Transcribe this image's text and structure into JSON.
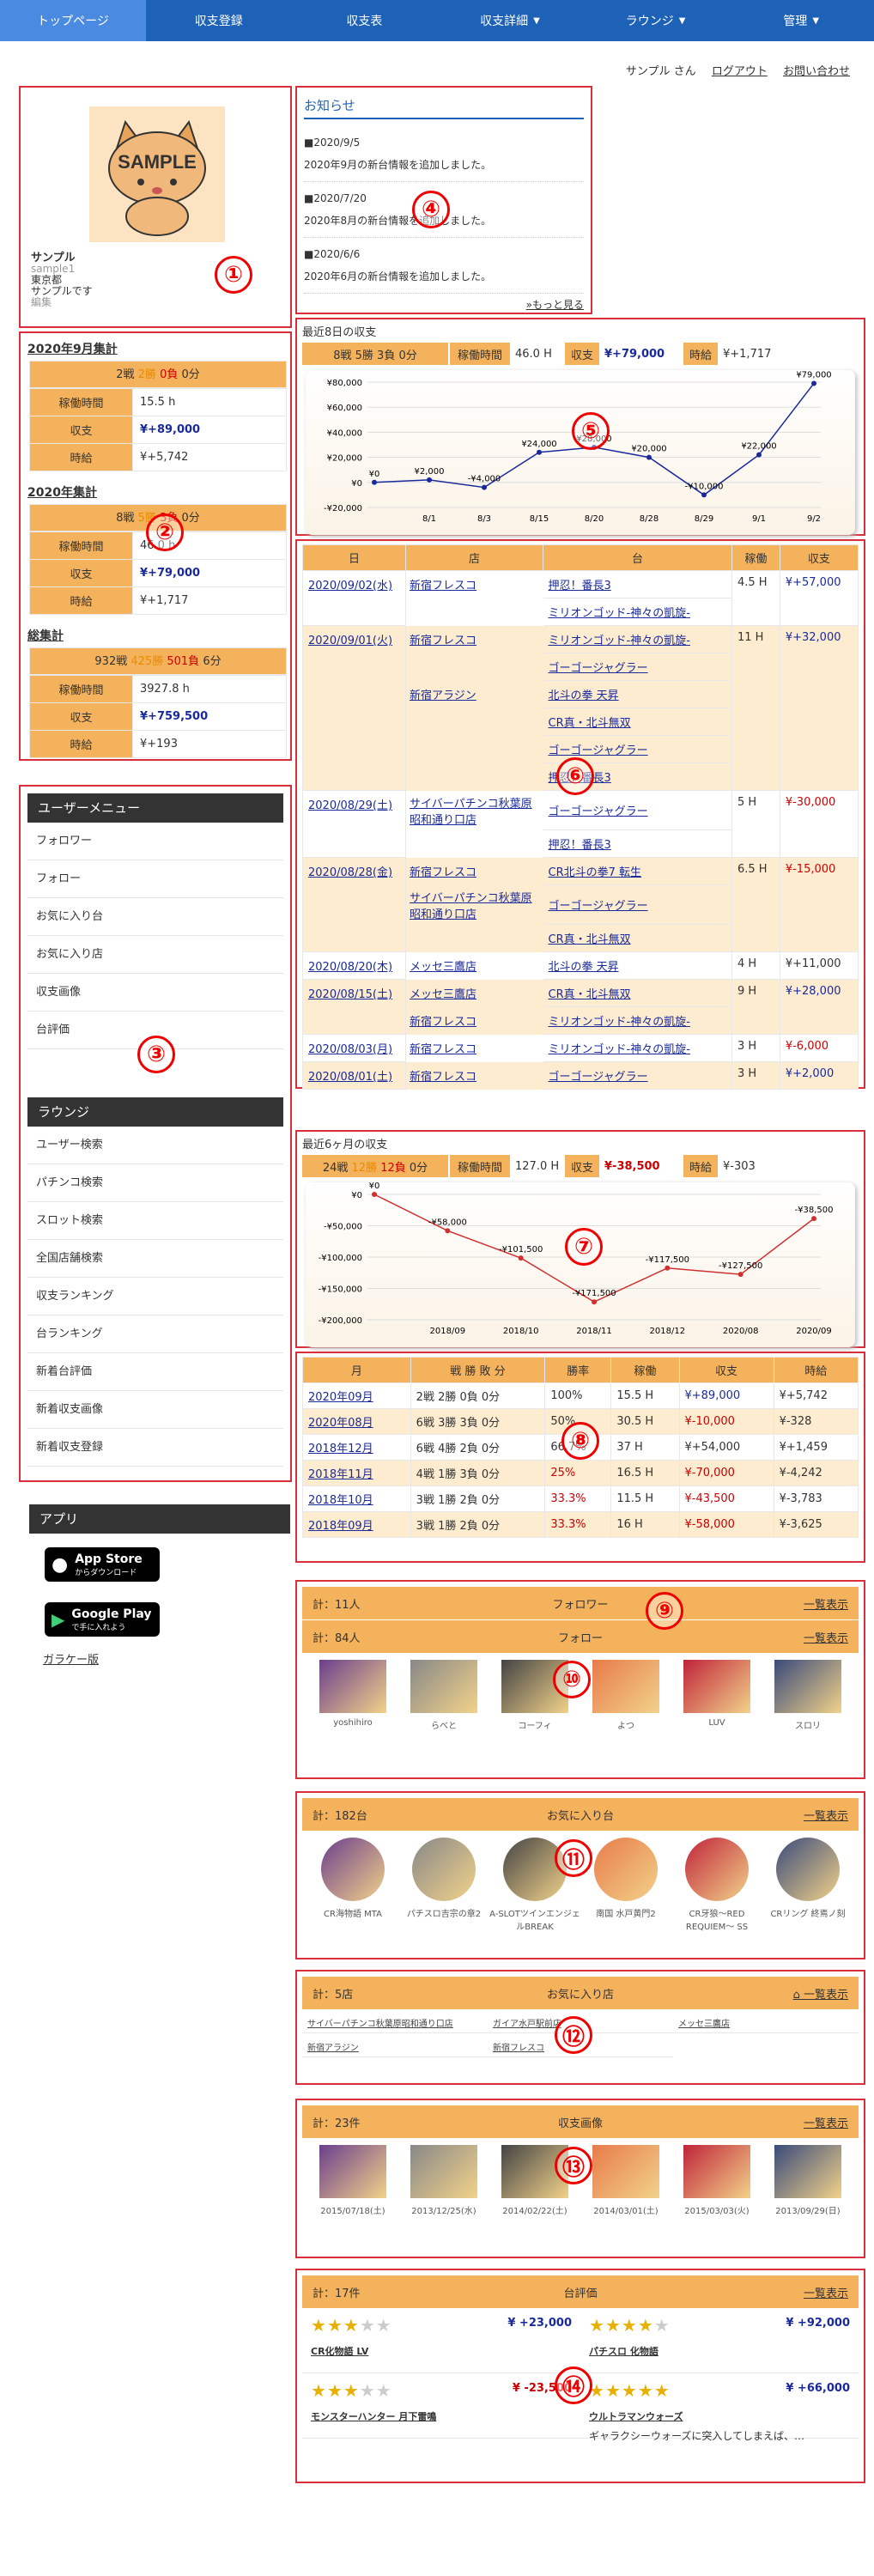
{
  "nav": {
    "items": [
      "トップページ",
      "収支登録",
      "収支表",
      "収支詳細",
      "ラウンジ",
      "管理"
    ]
  },
  "userbar": {
    "name": "サンプル",
    "suffix": "さん",
    "logout": "ログアウト",
    "contact": "お問い合わせ"
  },
  "profile": {
    "avatar_text": "SAMPLE",
    "name": "サンプル",
    "id": "sample1",
    "area": "東京都",
    "comment": "サンプルです",
    "edit": "編集"
  },
  "month_summary": {
    "title": "2020年9月集計",
    "games": "2戦",
    "wins": "2勝",
    "losses": "0負",
    "draws": "0分",
    "hours_label": "稼働時間",
    "hours": "15.5 h",
    "balance_label": "収支",
    "balance": "¥+89,000",
    "hourly_label": "時給",
    "hourly": "¥+5,742"
  },
  "year_summary": {
    "title": "2020年集計",
    "games": "8戦",
    "wins": "5勝",
    "losses": "3負",
    "draws": "0分",
    "hours_label": "稼働時間",
    "hours": "46.0 h",
    "balance_label": "収支",
    "balance": "¥+79,000",
    "hourly_label": "時給",
    "hourly": "¥+1,717"
  },
  "total_summary": {
    "title": "総集計",
    "games": "932戦",
    "wins": "425勝",
    "losses": "501負",
    "draws": "6分",
    "hours_label": "稼働時間",
    "hours": "3927.8 h",
    "balance_label": "収支",
    "balance": "¥+759,500",
    "hourly_label": "時給",
    "hourly": "¥+193"
  },
  "user_menu": {
    "title": "ユーザーメニュー",
    "items": [
      "フォロワー",
      "フォロー",
      "お気に入り台",
      "お気に入り店",
      "収支画像",
      "台評価"
    ]
  },
  "lounge_menu": {
    "title": "ラウンジ",
    "items": [
      "ユーザー検索",
      "パチンコ検索",
      "スロット検索",
      "全国店舗検索",
      "収支ランキング",
      "台ランキング",
      "新着台評価",
      "新着収支画像",
      "新着収支登録"
    ]
  },
  "apps": {
    "title": "アプリ",
    "appstore_main": "App Store",
    "appstore_sub": "からダウンロード",
    "google_main": "Google Play",
    "google_sub": "で手に入れよう",
    "feature": "ガラケー版"
  },
  "notice": {
    "title": "お知らせ",
    "items": [
      {
        "date": "■2020/9/5",
        "text": "2020年9月の新台情報を追加しました。"
      },
      {
        "date": "■2020/7/20",
        "text": "2020年8月の新台情報を追加しました。"
      },
      {
        "date": "■2020/6/6",
        "text": "2020年6月の新台情報を追加しました。"
      }
    ],
    "more": "»もっと見る"
  },
  "recent8": {
    "title": "最近8日の収支",
    "record": "8戦 5勝 3負 0分",
    "hours_label": "稼働時間",
    "hours": "46.0 H",
    "balance_label": "収支",
    "balance": "¥+79,000",
    "hourly_label": "時給",
    "hourly": "¥+1,717"
  },
  "chart_data": [
    {
      "type": "line",
      "categories": [
        "8/1",
        "8/3",
        "8/15",
        "8/20",
        "8/28",
        "8/29",
        "9/1",
        "9/2"
      ],
      "values": [
        0,
        2000,
        -4000,
        24000,
        28000,
        20000,
        -10000,
        22000,
        79000
      ],
      "labels": [
        "¥0",
        "¥2,000",
        "-¥4,000",
        "¥24,000",
        "¥28,000",
        "¥20,000",
        "-¥10,000",
        "¥22,000",
        "¥79,000"
      ],
      "ylim": [
        -20000,
        80000
      ],
      "yticks": [
        "¥80,000",
        "¥60,000",
        "¥40,000",
        "¥20,000",
        "¥0",
        "-¥20,000"
      ]
    },
    {
      "type": "line",
      "categories": [
        "2018/09",
        "2018/10",
        "2018/11",
        "2018/12",
        "2020/08",
        "2020/09"
      ],
      "values": [
        0,
        -58000,
        -101500,
        -171500,
        -117500,
        -127500,
        -38500
      ],
      "labels": [
        "¥0",
        "-¥58,000",
        "-¥101,500",
        "-¥171,500",
        "-¥117,500",
        "-¥127,500",
        "-¥38,500"
      ],
      "ylim": [
        -200000,
        0
      ],
      "yticks": [
        "¥0",
        "-¥50,000",
        "-¥100,000",
        "-¥150,000",
        "-¥200,000"
      ]
    }
  ],
  "daily_table": {
    "headers": [
      "日",
      "店",
      "台",
      "稼働",
      "収支"
    ],
    "rows": [
      {
        "date": "2020/09/02(水)",
        "entries": [
          {
            "store": "新宿フレスコ",
            "machines": [
              "押忍！番長3",
              "ミリオンゴッド-神々の凱旋-"
            ]
          }
        ],
        "hours": "4.5 H",
        "balance": "¥+57,000",
        "sign": "pos",
        "cream": false
      },
      {
        "date": "2020/09/01(火)",
        "entries": [
          {
            "store": "新宿フレスコ",
            "machines": [
              "ミリオンゴッド-神々の凱旋-",
              "ゴーゴージャグラー"
            ]
          },
          {
            "store": "新宿アラジン",
            "machines": [
              "北斗の拳 天昇",
              "CR真・北斗無双",
              "ゴーゴージャグラー",
              "押忍！番長3"
            ]
          }
        ],
        "hours": "11 H",
        "balance": "¥+32,000",
        "sign": "pos",
        "cream": true
      },
      {
        "date": "2020/08/29(土)",
        "entries": [
          {
            "store": "サイバーパチンコ秋葉原昭和通り口店",
            "machines": [
              "ゴーゴージャグラー",
              "押忍！番長3"
            ]
          }
        ],
        "hours": "5 H",
        "balance": "¥-30,000",
        "sign": "neg",
        "cream": false
      },
      {
        "date": "2020/08/28(金)",
        "entries": [
          {
            "store": "新宿フレスコ",
            "machines": [
              "CR北斗の拳7 転生"
            ]
          },
          {
            "store": "サイバーパチンコ秋葉原昭和通り口店",
            "machines": [
              "ゴーゴージャグラー",
              "CR真・北斗無双"
            ]
          }
        ],
        "hours": "6.5 H",
        "balance": "¥-15,000",
        "sign": "neg",
        "cream": true
      },
      {
        "date": "2020/08/20(木)",
        "entries": [
          {
            "store": "メッセ三鷹店",
            "machines": [
              "北斗の拳 天昇"
            ]
          }
        ],
        "hours": "4 H",
        "balance": "¥+11,000",
        "sign": "",
        "cream": false
      },
      {
        "date": "2020/08/15(土)",
        "entries": [
          {
            "store": "メッセ三鷹店",
            "machines": [
              "CR真・北斗無双"
            ]
          },
          {
            "store": "新宿フレスコ",
            "machines": [
              "ミリオンゴッド-神々の凱旋-"
            ]
          }
        ],
        "hours": "9 H",
        "balance": "¥+28,000",
        "sign": "pos",
        "cream": true
      },
      {
        "date": "2020/08/03(月)",
        "entries": [
          {
            "store": "新宿フレスコ",
            "machines": [
              "ミリオンゴッド-神々の凱旋-"
            ]
          }
        ],
        "hours": "3 H",
        "balance": "¥-6,000",
        "sign": "neg",
        "cream": false
      },
      {
        "date": "2020/08/01(土)",
        "entries": [
          {
            "store": "新宿フレスコ",
            "machines": [
              "ゴーゴージャグラー"
            ]
          }
        ],
        "hours": "3 H",
        "balance": "¥+2,000",
        "sign": "pos",
        "cream": true
      }
    ]
  },
  "recent6": {
    "title": "最近6ヶ月の収支",
    "games": "24戦",
    "wins": "12勝",
    "losses": "12負",
    "draws": "0分",
    "hours_label": "稼働時間",
    "hours": "127.0 H",
    "balance_label": "収支",
    "balance": "¥-38,500",
    "hourly_label": "時給",
    "hourly": "¥-303"
  },
  "monthly_table": {
    "headers": [
      "月",
      "戦 勝 敗 分",
      "勝率",
      "稼働",
      "収支",
      "時給"
    ],
    "rows": [
      {
        "month": "2020年09月",
        "record": "2戦 2勝 0負 0分",
        "rate": "100%",
        "hours": "15.5 H",
        "balance": "¥+89,000",
        "hourly": "¥+5,742",
        "sign": "pos",
        "rate_red": false
      },
      {
        "month": "2020年08月",
        "record": "6戦 3勝 3負 0分",
        "rate": "50%",
        "hours": "30.5 H",
        "balance": "¥-10,000",
        "hourly": "¥-328",
        "sign": "neg",
        "rate_red": false
      },
      {
        "month": "2018年12月",
        "record": "6戦 4勝 2負 0分",
        "rate": "66.7%",
        "hours": "37 H",
        "balance": "¥+54,000",
        "hourly": "¥+1,459",
        "sign": "",
        "rate_red": false
      },
      {
        "month": "2018年11月",
        "record": "4戦 1勝 3負 0分",
        "rate": "25%",
        "hours": "16.5 H",
        "balance": "¥-70,000",
        "hourly": "¥-4,242",
        "sign": "neg",
        "rate_red": true
      },
      {
        "month": "2018年10月",
        "record": "3戦 1勝 2負 0分",
        "rate": "33.3%",
        "hours": "11.5 H",
        "balance": "¥-43,500",
        "hourly": "¥-3,783",
        "sign": "neg",
        "rate_red": true
      },
      {
        "month": "2018年09月",
        "record": "3戦 1勝 2負 0分",
        "rate": "33.3%",
        "hours": "16 H",
        "balance": "¥-58,000",
        "hourly": "¥-3,625",
        "sign": "neg",
        "rate_red": true
      }
    ]
  },
  "followers": {
    "count": "計：11人",
    "title": "フォロワー",
    "link": "一覧表示"
  },
  "follows": {
    "count": "計：84人",
    "title": "フォロー",
    "link": "一覧表示",
    "users": [
      "yoshihiro",
      "らべと",
      "コーフィ",
      "よつ",
      "LUV",
      "スロリ"
    ]
  },
  "fav_machines": {
    "count": "計：182台",
    "title": "お気に入り台",
    "link": "一覧表示",
    "items": [
      "CR海物語 MTA",
      "パチスロ吉宗の章2",
      "A-SLOTツインエンジェルBREAK",
      "南国 水戸黄門2",
      "CR牙狼〜RED REQUIEM〜 SS",
      "CRリング 終焉ノ刻"
    ]
  },
  "fav_stores": {
    "count": "計：5店",
    "title": "お気に入り店",
    "link": "一覧表示",
    "items": [
      "サイバーパチンコ秋葉原昭和通り口店",
      "ガイア水戸駅前店",
      "メッセ三鷹店",
      "新宿アラジン",
      "新宿フレスコ"
    ]
  },
  "images": {
    "count": "計：23件",
    "title": "収支画像",
    "link": "一覧表示",
    "dates": [
      "2015/07/18(土)",
      "2013/12/25(水)",
      "2014/02/22(土)",
      "2014/03/01(土)",
      "2015/03/03(火)",
      "2013/09/29(日)"
    ]
  },
  "reviews": {
    "count": "計：17件",
    "title": "台評価",
    "link": "一覧表示",
    "items": [
      {
        "stars": 3,
        "amount": "¥ +23,000",
        "name": "CR化物語 LV",
        "sign": "pos"
      },
      {
        "stars": 4,
        "amount": "¥ +92,000",
        "name": "パチスロ 化物語",
        "sign": "pos"
      },
      {
        "stars": 3,
        "amount": "¥ -23,500",
        "name": "モンスターハンター 月下雷鳴",
        "sign": "neg"
      },
      {
        "stars": 5,
        "amount": "¥ +66,000",
        "name": "ウルトラマンウォーズ",
        "sign": "pos",
        "comment": "ギャラクシーウォーズに突入してしまえば、…"
      }
    ]
  },
  "markers": [
    "①",
    "②",
    "③",
    "④",
    "⑤",
    "⑥",
    "⑦",
    "⑧",
    "⑨",
    "⑩",
    "⑪",
    "⑫",
    "⑬",
    "⑭"
  ],
  "colors": {
    "nav": "#1e62b8",
    "accent": "#f5b25c",
    "cream": "#fdeccf",
    "outline": "#d92f3a",
    "positive": "#1a2a9c",
    "negative": "#cc0000"
  }
}
